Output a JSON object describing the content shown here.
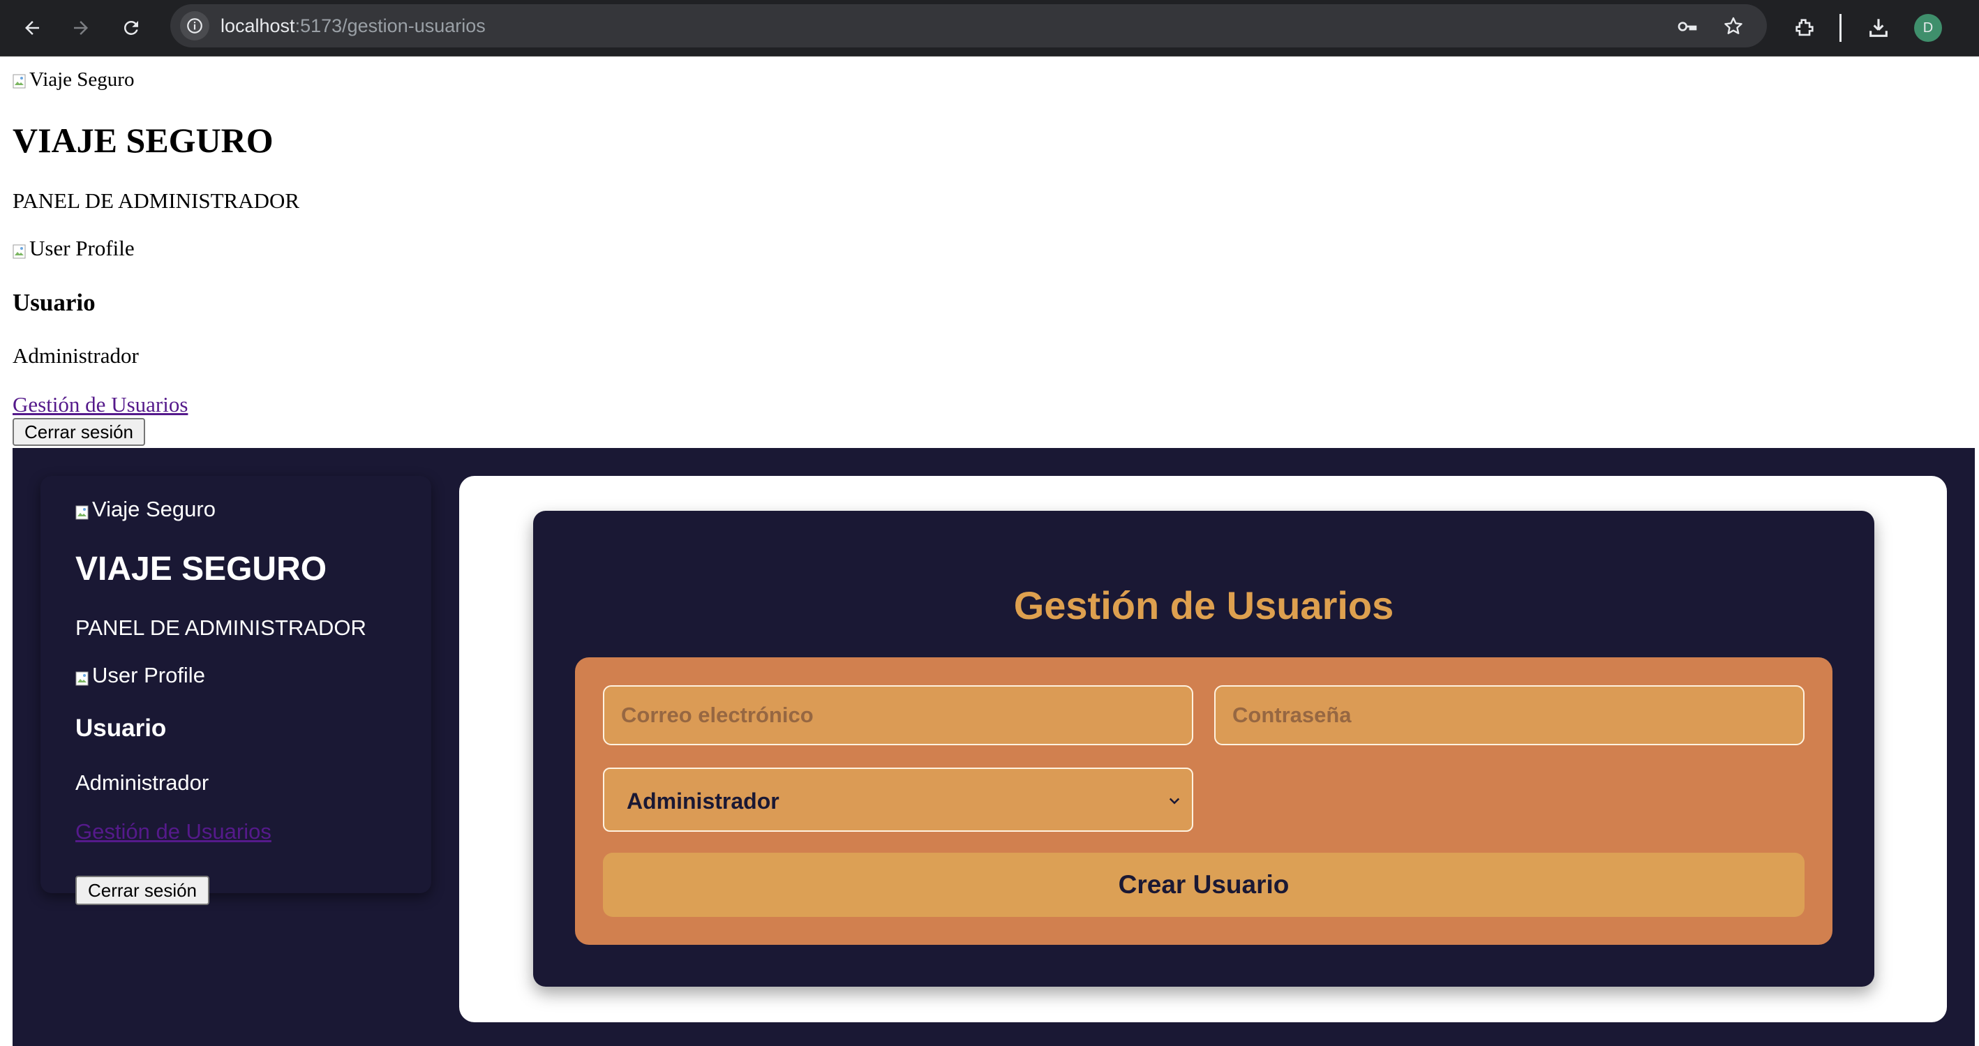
{
  "browser": {
    "url_host": "localhost",
    "url_path": ":5173/gestion-usuarios",
    "avatar_letter": "D"
  },
  "plain_header": {
    "logo_alt": "Viaje Seguro",
    "title": "VIAJE SEGURO",
    "subtitle": "PANEL DE ADMINISTRADOR",
    "profile_alt": "User Profile",
    "user_name": "Usuario",
    "user_role": "Administrador",
    "nav_link": "Gestión de Usuarios",
    "logout_label": "Cerrar sesión"
  },
  "sidebar": {
    "logo_alt": "Viaje Seguro",
    "title": "VIAJE SEGURO",
    "subtitle": "PANEL DE ADMINISTRADOR",
    "profile_alt": "User Profile",
    "user_name": "Usuario",
    "user_role": "Administrador",
    "nav_link": "Gestión de Usuarios",
    "logout_label": "Cerrar sesión"
  },
  "main": {
    "title": "Gestión de Usuarios",
    "form": {
      "email_placeholder": "Correo electrónico",
      "email_value": "",
      "password_placeholder": "Contraseña",
      "password_value": "",
      "role_selected": "Administrador",
      "submit_label": "Crear Usuario"
    }
  },
  "colors": {
    "app_background": "#1a1834",
    "accent_title": "#dea04f",
    "form_panel": "#d1804f",
    "input_fill": "#db9b55",
    "submit_button": "#dca055",
    "link": "#551a8b"
  }
}
